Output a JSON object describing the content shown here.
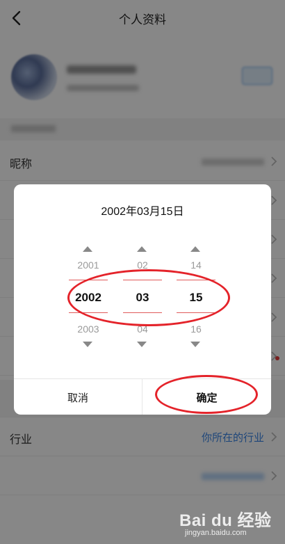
{
  "header": {
    "title": "个人资料"
  },
  "rows": [
    {
      "label": "昵称"
    },
    {
      "label": "行业",
      "value": "你所在的行业"
    }
  ],
  "picker": {
    "title": "2002年03月15日",
    "year": {
      "prev": "2001",
      "current": "2002",
      "next": "2003"
    },
    "month": {
      "prev": "02",
      "current": "03",
      "next": "04"
    },
    "day": {
      "prev": "14",
      "current": "15",
      "next": "16"
    },
    "cancel_label": "取消",
    "confirm_label": "确定"
  },
  "watermark": {
    "logo": "Bai du 经验",
    "url": "jingyan.baidu.com"
  },
  "colors": {
    "annotation": "#e4232a",
    "link": "#3a84e6",
    "overlay": "rgba(0,0,0,0.47)"
  }
}
